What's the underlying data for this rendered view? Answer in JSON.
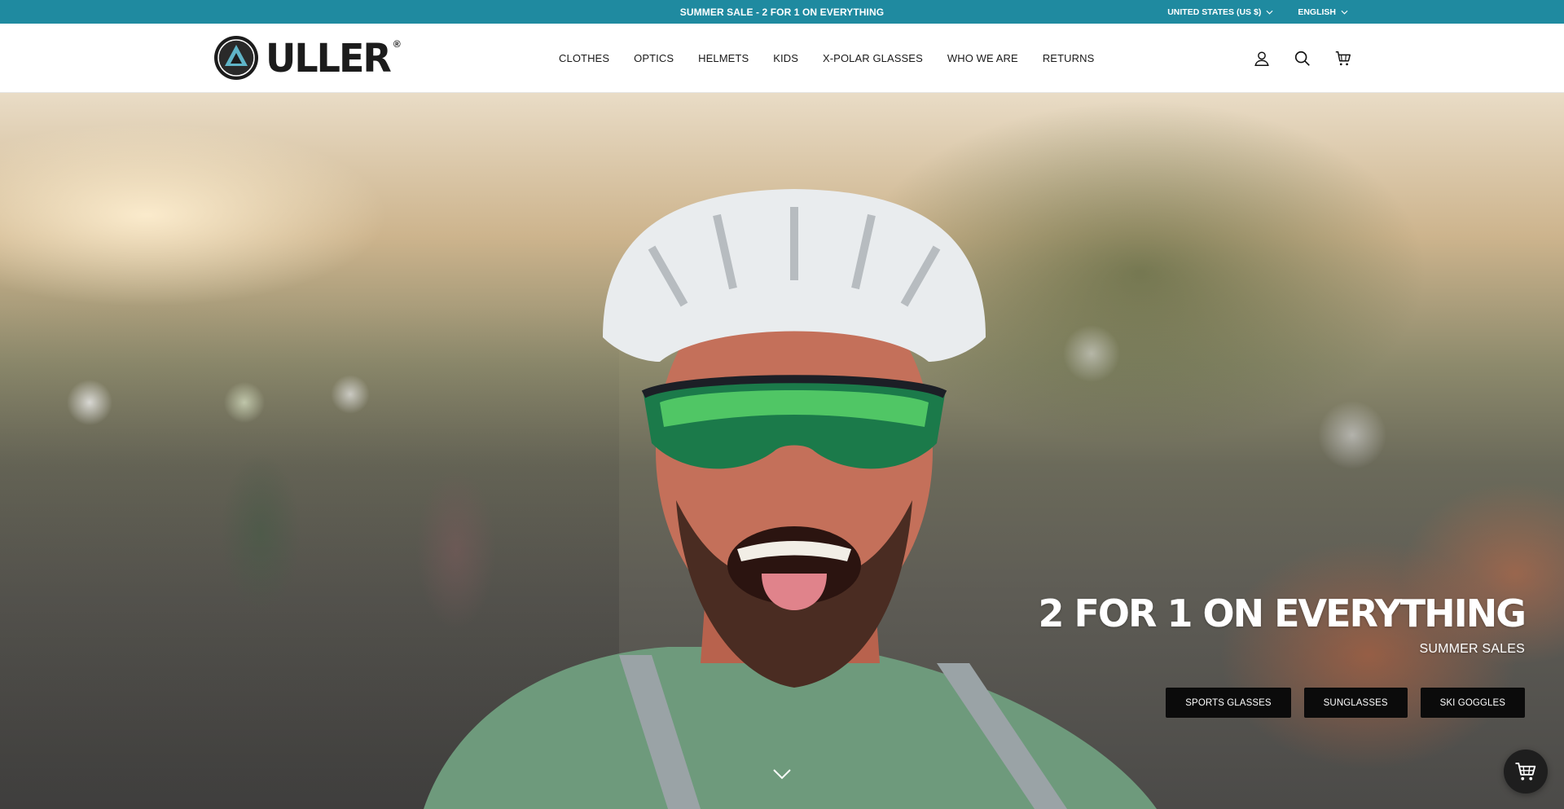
{
  "announcement": {
    "text": "SUMMER SALE - 2 FOR 1 ON EVERYTHING",
    "country": "UNITED STATES (US $)",
    "language": "ENGLISH",
    "background": "#1f8aa0"
  },
  "brand": {
    "name": "ULLER",
    "registered": "®"
  },
  "nav": {
    "items": [
      {
        "label": "CLOTHES"
      },
      {
        "label": "OPTICS"
      },
      {
        "label": "HELMETS"
      },
      {
        "label": "KIDS"
      },
      {
        "label": "X-POLAR GLASSES"
      },
      {
        "label": "WHO WE ARE"
      },
      {
        "label": "RETURNS"
      }
    ]
  },
  "header_icons": [
    "account-icon",
    "search-icon",
    "cart-icon"
  ],
  "hero": {
    "title": "2 FOR 1 ON EVERYTHING",
    "subtitle": "SUMMER SALES",
    "buttons": [
      {
        "label": "SPORTS GLASSES"
      },
      {
        "label": "SUNGLASSES"
      },
      {
        "label": "SKI GOGGLES"
      }
    ]
  },
  "floating": {
    "icon": "cart-icon"
  }
}
